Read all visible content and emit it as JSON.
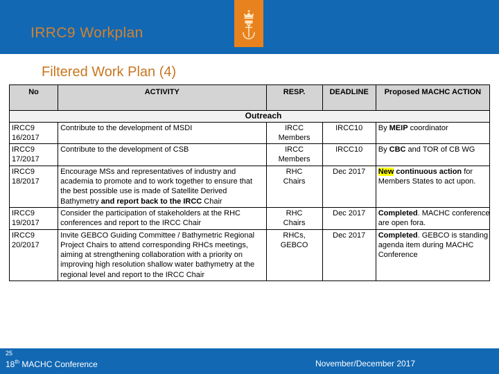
{
  "header": {
    "title": "IRRC9 Workplan",
    "band_color": "#1268b3",
    "title_color": "#d2822f",
    "logo": {
      "name": "crown-anchor-emblem",
      "plate_color": "#e8821e"
    }
  },
  "subtitle": {
    "text": "Filtered Work Plan (4)",
    "color": "#c8761f"
  },
  "table": {
    "columns": [
      {
        "key": "no",
        "label": "No"
      },
      {
        "key": "activity",
        "label": "ACTIVITY"
      },
      {
        "key": "resp",
        "label": "RESP."
      },
      {
        "key": "deadline",
        "label": "DEADLINE"
      },
      {
        "key": "action",
        "label": "Proposed MACHC ACTION"
      }
    ],
    "section_label": "Outreach",
    "highlight_color": "#ffff00",
    "header_bg": "#d4d4d4",
    "rows": [
      {
        "no": "IRCC9\n16/2017",
        "activity": "Contribute to the development of MSDI",
        "resp": "IRCC\nMembers",
        "deadline": "IRCC10",
        "action_html": "By <b>MEIP</b> coordinator"
      },
      {
        "no": "IRCC9\n17/2017",
        "activity": "Contribute to the development of CSB",
        "resp": "IRCC\nMembers",
        "deadline": "IRCC10",
        "action_html": "By <b>CBC</b> and TOR of CB WG"
      },
      {
        "no": "IRCC9\n18/2017",
        "activity": "Encourage MSs and representatives of industry and academia to promote  and to work together to ensure that the best possible use is made of Satellite Derived Bathymetry <b>and report back to the IRCC</b> Chair",
        "activity_html": true,
        "resp": "RHC\nChairs",
        "deadline": "Dec 2017",
        "action_html": "<span class=\"hl\">New</span> <b>continuous action</b> for Members States to act upon."
      },
      {
        "no": "IRCC9\n19/2017",
        "activity": "Consider the participation of stakeholders at the RHC conferences and report to the IRCC Chair",
        "resp": "RHC\nChairs",
        "deadline": "Dec 2017",
        "action_html": "<b>Completed</b>. MACHC conference are open fora."
      },
      {
        "no": "IRCC9\n20/2017",
        "activity": "Invite GEBCO Guiding Committee / Bathymetric Regional Project Chairs to attend corresponding RHCs meetings, aiming at strengthening collaboration with a priority on improving high resolution shallow water bathymetry at the regional level and report to the IRCC Chair",
        "resp": "RHCs,\nGEBCO",
        "deadline": "Dec 2017",
        "action_html": "<b>Completed</b>. GEBCO is standing agenda item during MACHC Conference"
      }
    ]
  },
  "footer": {
    "page_number": "25",
    "left_prefix": "18",
    "left_sup": "th",
    "left_rest": " MACHC Conference",
    "right": "November/December 2017",
    "band_color": "#1268b3"
  }
}
